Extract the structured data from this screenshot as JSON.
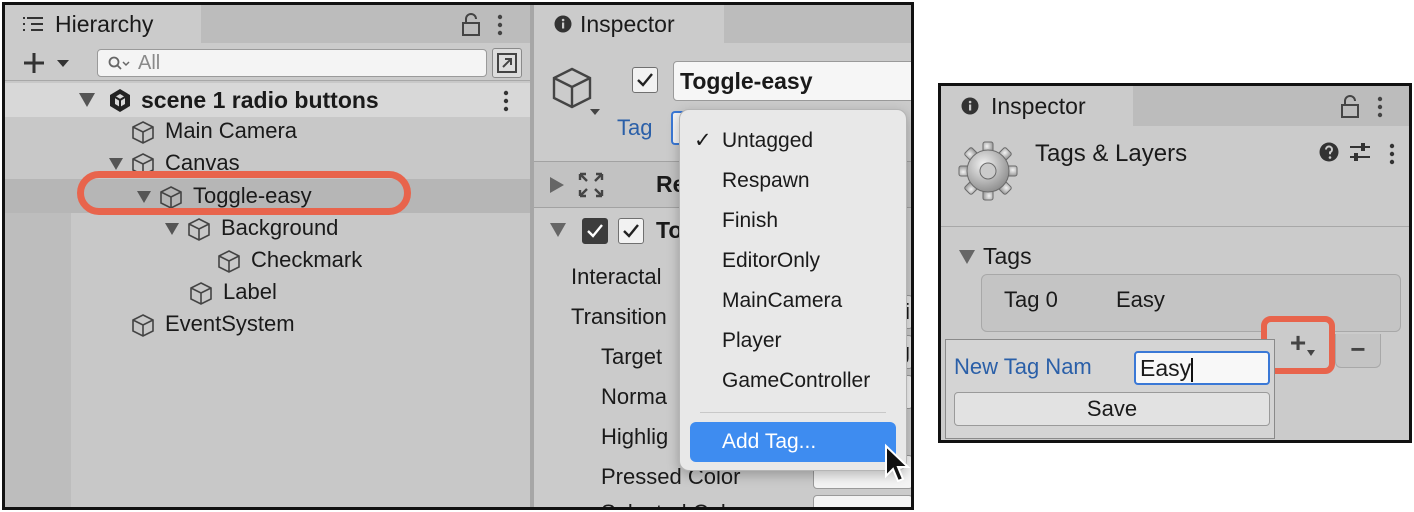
{
  "left": {
    "hierarchy": {
      "tab_label": "Hierarchy",
      "search_placeholder": "All",
      "scene": "scene 1 radio buttons",
      "items": [
        {
          "label": "Main Camera"
        },
        {
          "label": "Canvas"
        },
        {
          "label": "Toggle-easy"
        },
        {
          "label": "Background"
        },
        {
          "label": "Checkmark"
        },
        {
          "label": "Label"
        },
        {
          "label": "EventSystem"
        }
      ]
    },
    "inspector": {
      "tab_label": "Inspector",
      "object_name": "Toggle-easy",
      "tag_label": "Tag",
      "component_1_partial": "Re",
      "component_2_partial": "To",
      "properties": [
        "Interactal",
        "Transition",
        "Target",
        "Norma",
        "Highlig",
        "Pressed Color",
        "Selected Color"
      ],
      "right_edge_text_1": "i",
      "right_edge_text_2": "g"
    },
    "tag_menu": {
      "items": [
        "Untagged",
        "Respawn",
        "Finish",
        "EditorOnly",
        "MainCamera",
        "Player",
        "GameController"
      ],
      "checked_item": "Untagged",
      "add_tag": "Add Tag...",
      "check_glyph": "✓"
    }
  },
  "right": {
    "inspector": {
      "tab_label": "Inspector",
      "title": "Tags & Layers",
      "section": "Tags",
      "tag_row": {
        "name": "Tag 0",
        "value": "Easy"
      }
    },
    "popup": {
      "label": "New Tag Nam",
      "input_value": "Easy",
      "save_label": "Save"
    },
    "buttons": {
      "plus": "+",
      "minus": "−"
    }
  },
  "colors": {
    "highlight": "#e8644c",
    "menu_selected": "#3e8cf0",
    "link_blue": "#2a5fa8",
    "panel_bg": "#cbcbcb"
  },
  "icons": [
    "hierarchy-tab-icon",
    "lock-icon",
    "kebab-menu-icon",
    "add-icon",
    "search-icon",
    "cube-icon",
    "unity-logo-icon",
    "info-icon",
    "gear-icon",
    "help-icon",
    "settings-sliders-icon",
    "cursor-icon",
    "checkmark-icon"
  ]
}
